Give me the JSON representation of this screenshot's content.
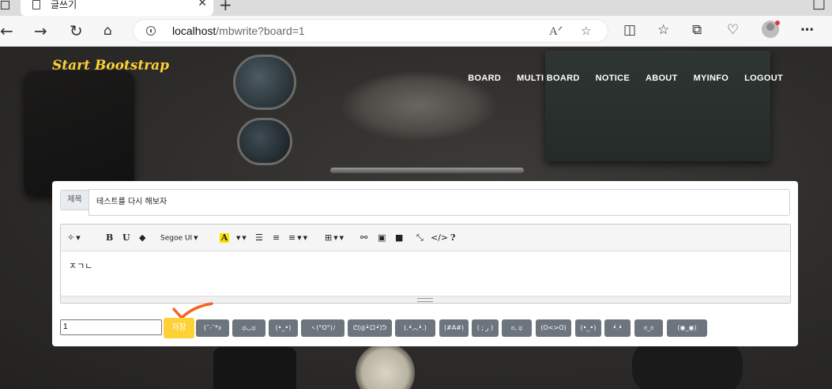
{
  "browser": {
    "tab_title": "글쓰기",
    "tab_close": "✕",
    "new_tab": "+",
    "url_host": "localhost",
    "url_path": "/mbwrite?board=1",
    "icons": [
      "back-icon",
      "forward-icon",
      "refresh-icon",
      "home-icon",
      "read-aloud-icon",
      "favorite-icon",
      "split-screen-icon",
      "favorites-icon",
      "collections-icon",
      "performance-icon",
      "profile-icon",
      "more-icon"
    ]
  },
  "navbar": {
    "brand": "Start Bootstrap",
    "menu": [
      "BOARD",
      "MULTI BOARD",
      "NOTICE",
      "ABOUT",
      "MYINFO",
      "LOGOUT"
    ]
  },
  "form": {
    "title_label": "제목",
    "title_value": "테스트를 다시 해보자",
    "editor_content": "ㅈㄱㄴ",
    "toolbar": {
      "font_name": "Segoe UI",
      "bold": "B",
      "underline": "U",
      "highlight": "A",
      "help": "?"
    },
    "number_value": "1",
    "save_label": "저장",
    "emoticons": [
      "(˘-˘*ง",
      "ಥ◡ಥ",
      "(•_•)",
      "ヽ(°O°)ﾉ",
      "ᕦ(◎•̀ロ•́)ᕤ",
      "(.•́︿•̀.)",
      "(#A#)",
      "( ; ر )",
      "ಠ, ಥ",
      "(O<>O)",
      "(•_•)",
      "•́.•̀",
      "ಠ_ಠ",
      "(◉_◉)"
    ]
  },
  "colors": {
    "brand": "#fed136",
    "save_button": "#fed136",
    "emoticon_button": "#6c757d",
    "check_mark": "#f26522"
  }
}
